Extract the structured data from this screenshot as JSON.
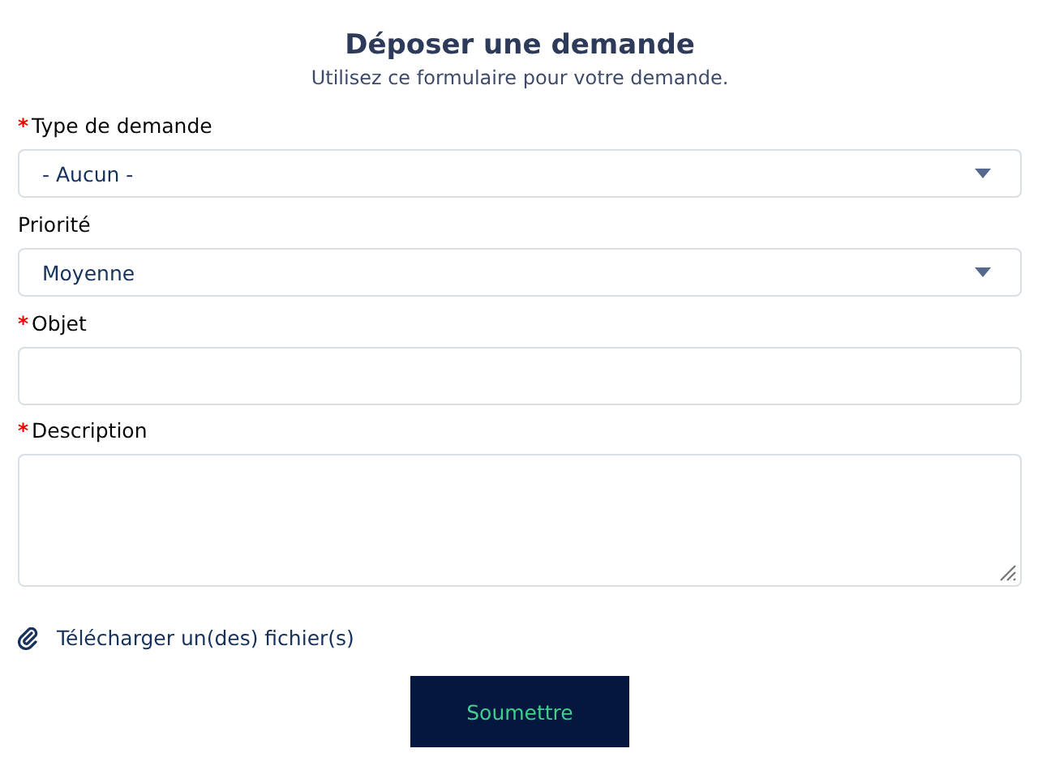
{
  "title": "Déposer une demande",
  "subtitle": "Utilisez ce formulaire pour votre demande.",
  "fields": [
    {
      "kind": "select",
      "label": "Type de demande",
      "required_mark": "*",
      "value": "- Aucun -"
    },
    {
      "kind": "select",
      "label": "Priorité",
      "value": "Moyenne"
    },
    {
      "kind": "input",
      "label": "Objet",
      "required_mark": "*"
    },
    {
      "kind": "textarea",
      "label": "Description",
      "required_mark": "*"
    }
  ],
  "attachment_link": "Télécharger un(des) fichier(s)",
  "submit_button": "Soumettre"
}
